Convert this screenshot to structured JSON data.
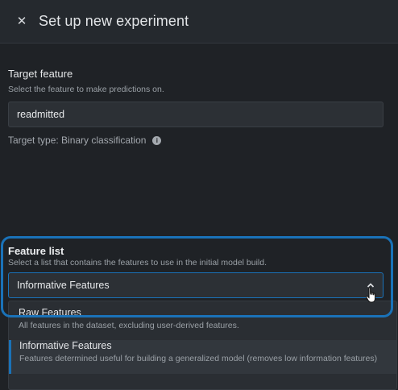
{
  "header": {
    "close_icon": "close-icon",
    "title": "Set up new experiment"
  },
  "target_feature": {
    "title": "Target feature",
    "description": "Select the feature to make predictions on.",
    "value": "readmitted",
    "target_type": "Target type: Binary classification",
    "info_icon": "info-icon"
  },
  "feature_list": {
    "title": "Feature list",
    "description": "Select a list that contains the features to use in the initial model build.",
    "selected": "Informative Features",
    "chevron_icon": "chevron-up-icon",
    "highlight_color": "#1a72b8",
    "options": [
      {
        "label": "Raw Features",
        "description": "All features in the dataset, excluding user-derived features."
      },
      {
        "label": "Informative Features",
        "description": "Features determined useful for building a generalized model (removes low information features)"
      }
    ]
  }
}
